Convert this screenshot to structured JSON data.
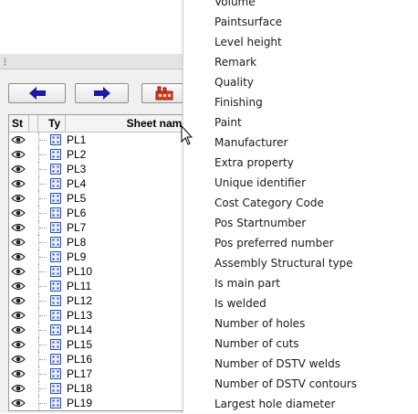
{
  "sheet_list": {
    "headers": {
      "status": "St",
      "type": "Ty",
      "sheet_name": "Sheet name"
    },
    "rows": [
      "PL1",
      "PL2",
      "PL3",
      "PL4",
      "PL5",
      "PL6",
      "PL7",
      "PL8",
      "PL9",
      "PL10",
      "PL11",
      "PL12",
      "PL13",
      "PL14",
      "PL15",
      "PL16",
      "PL17",
      "PL18",
      "PL19"
    ],
    "toolbar": {
      "back_icon": "arrow-left-icon",
      "forward_icon": "arrow-right-icon",
      "factory_icon": "factory-icon"
    }
  },
  "menu": {
    "items": [
      "Volume",
      "Paintsurface",
      "Level height",
      "Remark",
      "Quality",
      "Finishing",
      "Paint",
      "Manufacturer",
      "Extra property",
      "Unique identifier",
      "Cost Category Code",
      "Pos Startnumber",
      "Pos preferred number",
      "Assembly Structural type",
      "Is main part",
      "Is welded",
      "Number of holes",
      "Number of cuts",
      "Number of DSTV welds",
      "Number of DSTV contours",
      "Largest hole diameter"
    ]
  },
  "colors": {
    "arrow_blue": "#1a1aa8",
    "factory_red": "#d83b2a"
  }
}
